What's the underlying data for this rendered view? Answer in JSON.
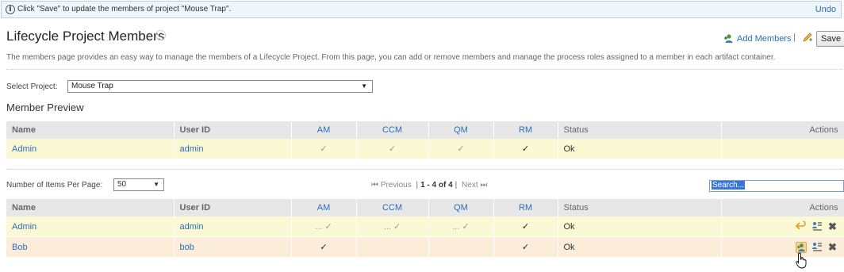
{
  "info_bar": {
    "icon": "info-icon",
    "message": "Click \"Save\" to update the members of project \"Mouse Trap\".",
    "undo_label": "Undo"
  },
  "header": {
    "title": "Lifecycle Project Members",
    "help_icon": "help-icon",
    "add_members_label": "Add Members",
    "separator": "|",
    "save_label": "Save"
  },
  "description": "The members page provides an easy way to manage the members of a Lifecycle Project. From this page, you can add or remove members and manage the process roles assigned to a member in each artifact container.",
  "project_select": {
    "label": "Select Project:",
    "value": "Mouse Trap"
  },
  "member_preview": {
    "heading": "Member Preview",
    "columns": [
      "Name",
      "User ID",
      "AM",
      "CCM",
      "QM",
      "RM",
      "Status",
      "Actions"
    ],
    "rows": [
      {
        "name": "Admin",
        "user_id": "admin",
        "am": "✓",
        "ccm": "✓",
        "qm": "✓",
        "rm": "✓",
        "status": "Ok"
      }
    ]
  },
  "paging": {
    "items_per_page_label": "Number of Items Per Page:",
    "items_per_page_value": "50",
    "previous_label": "Previous",
    "range_label": "1 - 4 of 4",
    "next_label": "Next",
    "search_value": "Search..."
  },
  "members_table": {
    "columns": [
      "Name",
      "User ID",
      "AM",
      "CCM",
      "QM",
      "RM",
      "Status",
      "Actions"
    ],
    "rows": [
      {
        "name": "Admin",
        "user_id": "admin",
        "am": "... ✓",
        "ccm": "... ✓",
        "qm": "... ✓",
        "rm": "✓",
        "status": "Ok"
      },
      {
        "name": "Bob",
        "user_id": "bob",
        "am": "✓",
        "ccm": "",
        "qm": "",
        "rm": "✓",
        "status": "Ok"
      }
    ]
  },
  "colors": {
    "link": "#2a6ebb",
    "row_yellow": "#fbf8d4",
    "row_orange": "#fbedd9",
    "header_bg": "#e7e7e7",
    "info_bg": "#eef5fb"
  }
}
